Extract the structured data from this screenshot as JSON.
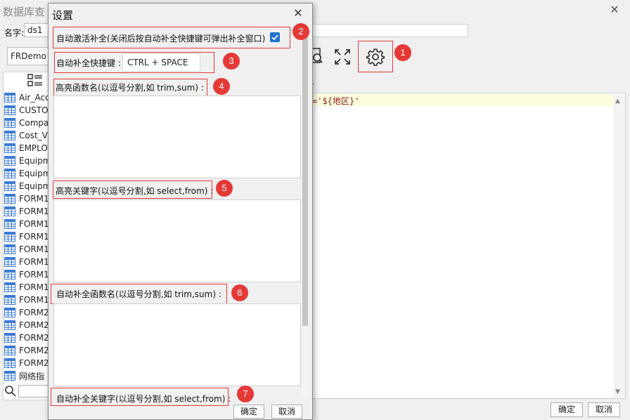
{
  "main": {
    "title": "数据库查",
    "name_label": "名字:",
    "name_value": "ds1",
    "database": "FRDemo",
    "sql_text": "='${地区}'",
    "ok_label": "确定",
    "cancel_label": "取消",
    "tables": [
      "Air_Acci",
      "CUSTO",
      "Compa",
      "Cost_VS",
      "EMPLOY",
      "Equipm",
      "Equipm",
      "Equipm",
      "FORM1",
      "FORM1",
      "FORM1",
      "FORM1",
      "FORM1",
      "FORM1",
      "FORM1",
      "FORM1",
      "FORM1",
      "FORM2",
      "FORM2",
      "FORM2",
      "FORM2",
      "FORM2",
      "网络指"
    ]
  },
  "dialog": {
    "title": "设置",
    "autocomplete_label": "自动激活补全(关闭后按自动补全快捷键可弹出补全窗口)",
    "autocomplete_checked": true,
    "shortcut_label": "自动补全快捷键 :",
    "shortcut_value": "CTRL + SPACE",
    "hl_func_label": "高亮函数名(以逗号分割,如 trim,sum) :",
    "hl_kw_label": "高亮关键字(以逗号分割,如 select,from) :",
    "ac_func_label": "自动补全函数名(以逗号分割,如 trim,sum) :",
    "ac_kw_label": "自动补全关键字(以逗号分割,如 select,from) :",
    "ok_label": "确定",
    "cancel_label": "取消"
  },
  "badges": [
    "1",
    "2",
    "3",
    "4",
    "5",
    "6",
    "7"
  ],
  "colors": {
    "annotation_red": "#e53935",
    "checkbox_blue": "#1e73d0",
    "table_icon_blue": "#3a7bd5"
  },
  "icons": {
    "settings": "gear-icon",
    "preview": "magnifier-icon",
    "fullscreen": "expand-icon",
    "table": "table-grid-icon"
  }
}
